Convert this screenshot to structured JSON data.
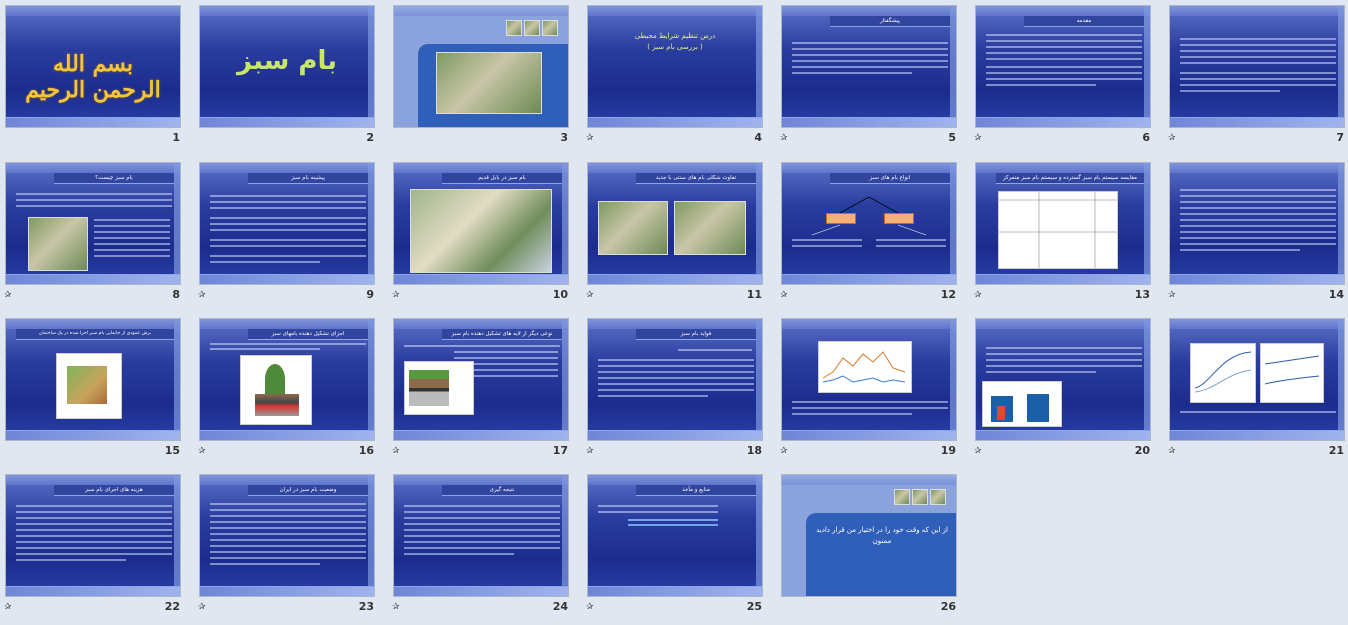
{
  "slides": [
    {
      "num": "1",
      "title": "",
      "star": ""
    },
    {
      "num": "2",
      "title": "",
      "star": "",
      "big": "بام سبز"
    },
    {
      "num": "3",
      "title": "",
      "star": ""
    },
    {
      "num": "4",
      "title": "",
      "star": "✰",
      "mid1": "درس تنظیم شرایط محیطی",
      "mid2": "( بررسی بام سبز )"
    },
    {
      "num": "5",
      "title": "پیشگفتار",
      "star": "✰"
    },
    {
      "num": "6",
      "title": "مقدمه",
      "star": "✰"
    },
    {
      "num": "7",
      "title": "",
      "star": "✰"
    },
    {
      "num": "8",
      "title": "بام سبز چیست؟",
      "star": "✰"
    },
    {
      "num": "9",
      "title": "پیشینه بام سبز",
      "star": "✰"
    },
    {
      "num": "10",
      "title": "بام سبز در بابل قدیم",
      "star": "✰"
    },
    {
      "num": "11",
      "title": "تفاوت شکلی بام های سنتی با جدید",
      "star": "✰"
    },
    {
      "num": "12",
      "title": "انواع بام های سبز",
      "star": "✰"
    },
    {
      "num": "13",
      "title": "مقایسه سیستم بام سبز گسترده و سیستم بام سبز متمرکز",
      "star": "✰"
    },
    {
      "num": "14",
      "title": "",
      "star": "✰"
    },
    {
      "num": "15",
      "title": "برش عمودی از جانمایی بام سبز اجرا شده در یک ساختمان",
      "star": "✰"
    },
    {
      "num": "16",
      "title": "اجزای تشکیل دهنده بامهای سبز",
      "star": "✰"
    },
    {
      "num": "17",
      "title": "نوعی دیگر از لایه های تشکیل دهنده بام سبز",
      "star": "✰"
    },
    {
      "num": "18",
      "title": "فواید بام سبز",
      "star": "✰"
    },
    {
      "num": "19",
      "title": "",
      "star": "✰"
    },
    {
      "num": "20",
      "title": "",
      "star": "✰"
    },
    {
      "num": "21",
      "title": "",
      "star": "✰"
    },
    {
      "num": "22",
      "title": "هزینه های اجرای بام سبز",
      "star": "✰"
    },
    {
      "num": "23",
      "title": "وضعیت بام سبز در ایران",
      "star": "✰"
    },
    {
      "num": "24",
      "title": "نتیجه گیری",
      "star": "✰"
    },
    {
      "num": "25",
      "title": "منابع و مآخذ",
      "star": "✰"
    },
    {
      "num": "26",
      "title": "",
      "star": "",
      "end": "از این که وقت خود را در اختیار من قرار دادید ممنون"
    }
  ],
  "slide1": {
    "callig": "بسم الله الرحمن الرحیم"
  }
}
